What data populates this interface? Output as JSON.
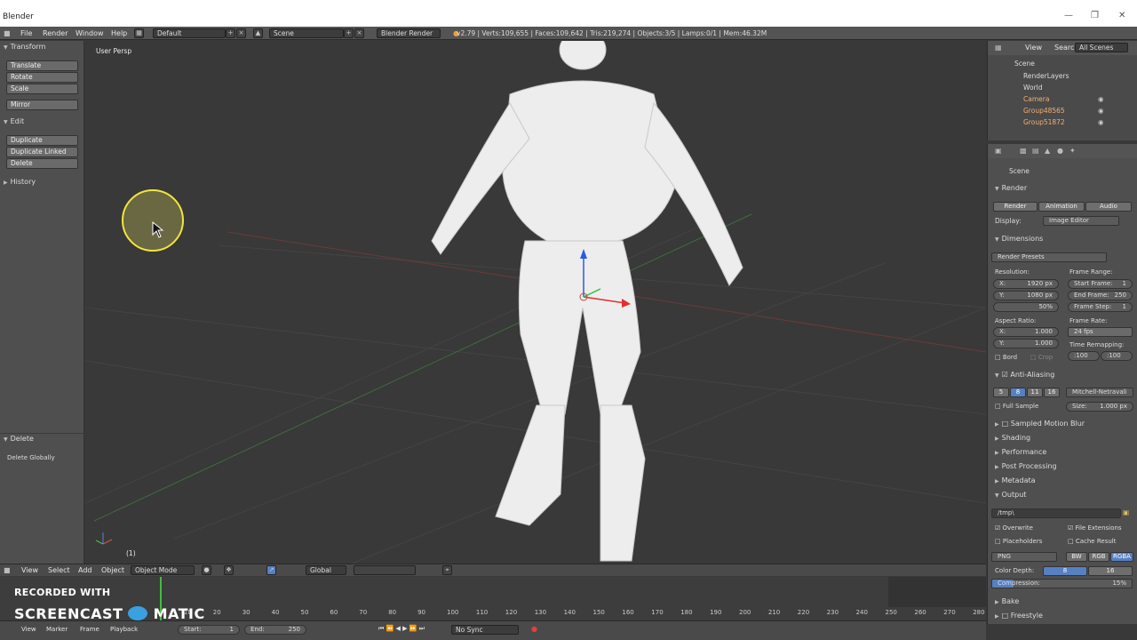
{
  "window": {
    "title": "Blender"
  },
  "menu": {
    "items": [
      "File",
      "Render",
      "Window",
      "Help"
    ],
    "screen": "Default",
    "scene": "Scene",
    "engine": "Blender Render",
    "stats": "v2.79 | Verts:109,655 | Faces:109,642 | Tris:219,274 | Objects:3/5 | Lamps:0/1 | Mem:46.32M"
  },
  "toolshelf": {
    "transform_header": "Transform",
    "transform": [
      "Translate",
      "Rotate",
      "Scale"
    ],
    "mirror": "Mirror",
    "edit_header": "Edit",
    "edit": [
      "Duplicate",
      "Duplicate Linked",
      "Delete"
    ],
    "history_header": "History",
    "op_header": "Delete",
    "op_item": "Delete Globally"
  },
  "viewport": {
    "view_label": "User Persp",
    "frame_label": "(1)"
  },
  "outliner": {
    "menu": [
      "View",
      "Search"
    ],
    "filter": "All Scenes",
    "items": [
      "Scene",
      "RenderLayers",
      "World",
      "Camera",
      "Group48565",
      "Group51872"
    ]
  },
  "properties": {
    "context": "Scene",
    "render_header": "Render",
    "render_buttons": [
      "Render",
      "Animation",
      "Audio"
    ],
    "display_label": "Display:",
    "display_value": "Image Editor",
    "dimensions_header": "Dimensions",
    "presets": "Render Presets",
    "resolution_label": "Resolution:",
    "res_x": "X:",
    "res_x_val": "1920 px",
    "res_y": "Y:",
    "res_y_val": "1080 px",
    "res_pct": "50%",
    "frame_range_label": "Frame Range:",
    "start": "Start Frame:",
    "start_val": "1",
    "end": "End Frame:",
    "end_val": "250",
    "step": "Frame Step:",
    "step_val": "1",
    "aspect_label": "Aspect Ratio:",
    "asp_x": "X:",
    "asp_x_val": "1.000",
    "asp_y": "Y:",
    "asp_y_val": "1.000",
    "frame_rate_label": "Frame Rate:",
    "fps": "24 fps",
    "remap_label": "Time Remapping:",
    "remap_old": ":100",
    "remap_new": ":100",
    "bord": "Bord",
    "crop": "Crop",
    "aa_header": "Anti-Aliasing",
    "aa_samples": [
      "5",
      "8",
      "11",
      "16"
    ],
    "aa_filter": "Mitchell-Netravali",
    "full_sample": "Full Sample",
    "size": "Size:",
    "size_val": "1.000 px",
    "panels": [
      "Sampled Motion Blur",
      "Shading",
      "Performance",
      "Post Processing",
      "Metadata"
    ],
    "output_header": "Output",
    "output_path": "/tmp\\",
    "overwrite": "Overwrite",
    "file_ext": "File Extensions",
    "placeholders": "Placeholders",
    "cache": "Cache Result",
    "format": "PNG",
    "color_modes": [
      "BW",
      "RGB",
      "RGBA"
    ],
    "color_depth": "Color Depth:",
    "depth_vals": [
      "8",
      "16"
    ],
    "compression": "Compression:",
    "compression_val": "15%",
    "bake": "Bake",
    "freestyle": "Freestyle"
  },
  "vpheader": {
    "menu": [
      "View",
      "Select",
      "Add",
      "Object"
    ],
    "mode": "Object Mode",
    "orientation": "Global"
  },
  "timeline": {
    "ticks": [
      "0",
      "10",
      "20",
      "30",
      "40",
      "50",
      "60",
      "70",
      "80",
      "90",
      "100",
      "110",
      "120",
      "130",
      "140",
      "150",
      "160",
      "170",
      "180",
      "190",
      "200",
      "210",
      "220",
      "230",
      "240",
      "250",
      "260",
      "270",
      "280"
    ],
    "start": "Start:",
    "start_val": "1",
    "end": "End:",
    "end_val": "250",
    "sync": "No Sync",
    "menu": [
      "View",
      "Marker",
      "Frame",
      "Playback"
    ]
  },
  "watermark": {
    "line1": "RECORDED WITH",
    "line2a": "SCREENCAST",
    "line2b": "MATIC"
  },
  "colors": {
    "accent": "#5680c2",
    "cursor_ring": "#f3e63a"
  }
}
